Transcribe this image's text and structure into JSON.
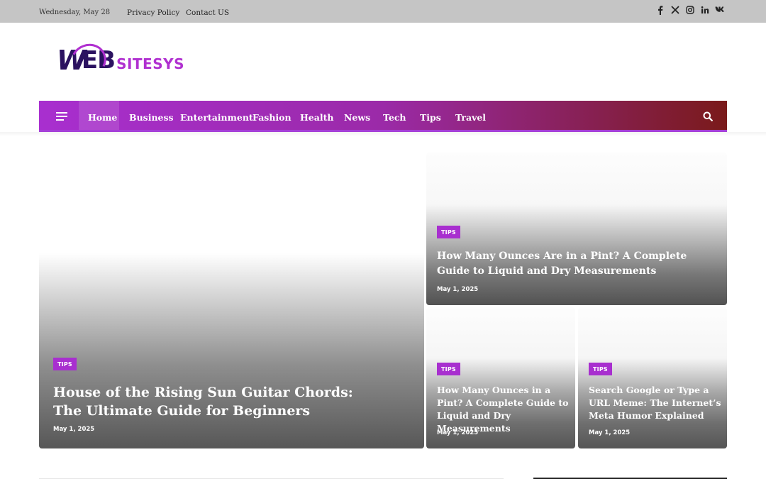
{
  "topbar": {
    "date": "Wednesday, May 28",
    "links": [
      "Privacy Policy",
      "Contact US"
    ],
    "social_icons": [
      "facebook-icon",
      "x-icon",
      "instagram-icon",
      "linkedin-icon",
      "vk-icon"
    ]
  },
  "logo": {
    "part1": "W",
    "part2": "EB",
    "part3": "SITESYS"
  },
  "nav": {
    "items": [
      "Home",
      "Business",
      "Entertainment",
      "Fashion",
      "Health",
      "News",
      "Tech",
      "Tips",
      "Travel"
    ],
    "active": "Home"
  },
  "colors": {
    "accent": "#a82fcf",
    "nav_end": "#7a1a1a",
    "logo_dark": "#2b1260"
  },
  "posts": [
    {
      "tag": "TIPS",
      "title": "House of the Rising Sun Guitar Chords: The Ultimate Guide for Beginners",
      "date": "May 1, 2025"
    },
    {
      "tag": "TIPS",
      "title": "How Many Ounces Are in a Pint? A Complete Guide to Liquid and Dry Measurements",
      "date": "May 1, 2025"
    },
    {
      "tag": "TIPS",
      "title": "How Many Ounces in a Pint? A Complete Guide to Liquid and Dry Measurements",
      "date": "May 1, 2025"
    },
    {
      "tag": "TIPS",
      "title": "Search Google or Type a URL Meme: The Internet’s Meta Humor Explained",
      "date": "May 1, 2025"
    }
  ]
}
